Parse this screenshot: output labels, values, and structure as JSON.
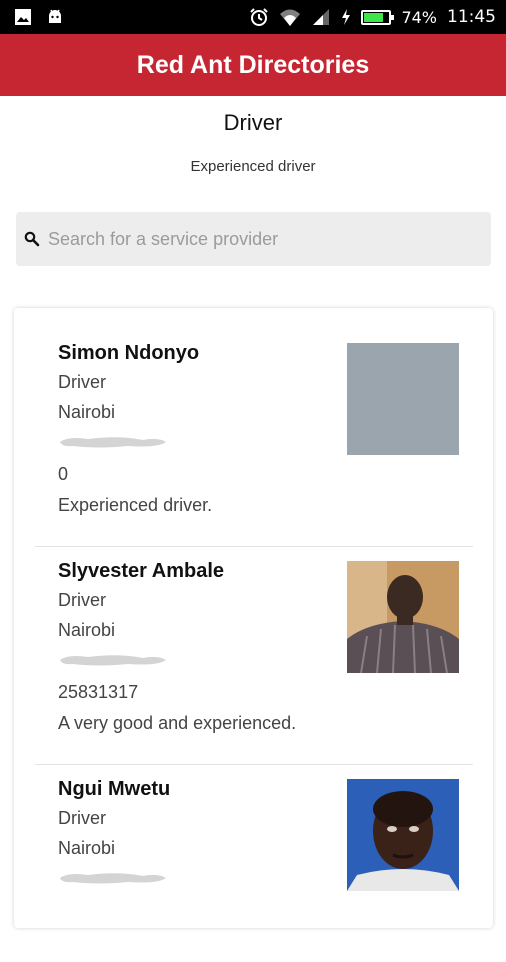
{
  "status_bar": {
    "battery": "74%",
    "time": "11:45",
    "battery_level": 0.74,
    "icons": [
      "image-icon",
      "android-icon",
      "alarm-icon",
      "wifi-icon",
      "signal-icon",
      "charging-icon",
      "battery-icon"
    ]
  },
  "app": {
    "title": "Red Ant Directories",
    "color": "#c62532"
  },
  "category": {
    "title": "Driver",
    "subtitle": "Experienced driver"
  },
  "search": {
    "placeholder": "Search for a service provider",
    "value": ""
  },
  "providers": [
    {
      "name": "Simon Ndonyo",
      "role": "Driver",
      "location": "Nairobi",
      "id": "0",
      "description": "Experienced driver.",
      "photo": "grey-placeholder"
    },
    {
      "name": "Slyvester Ambale",
      "role": "Driver",
      "location": "Nairobi",
      "id": "25831317",
      "description": "A very good and experienced.",
      "photo": "man-striped-shirt"
    },
    {
      "name": "Ngui Mwetu",
      "role": "Driver",
      "location": "Nairobi",
      "id": "",
      "description": "",
      "photo": "man-blue-background"
    }
  ]
}
